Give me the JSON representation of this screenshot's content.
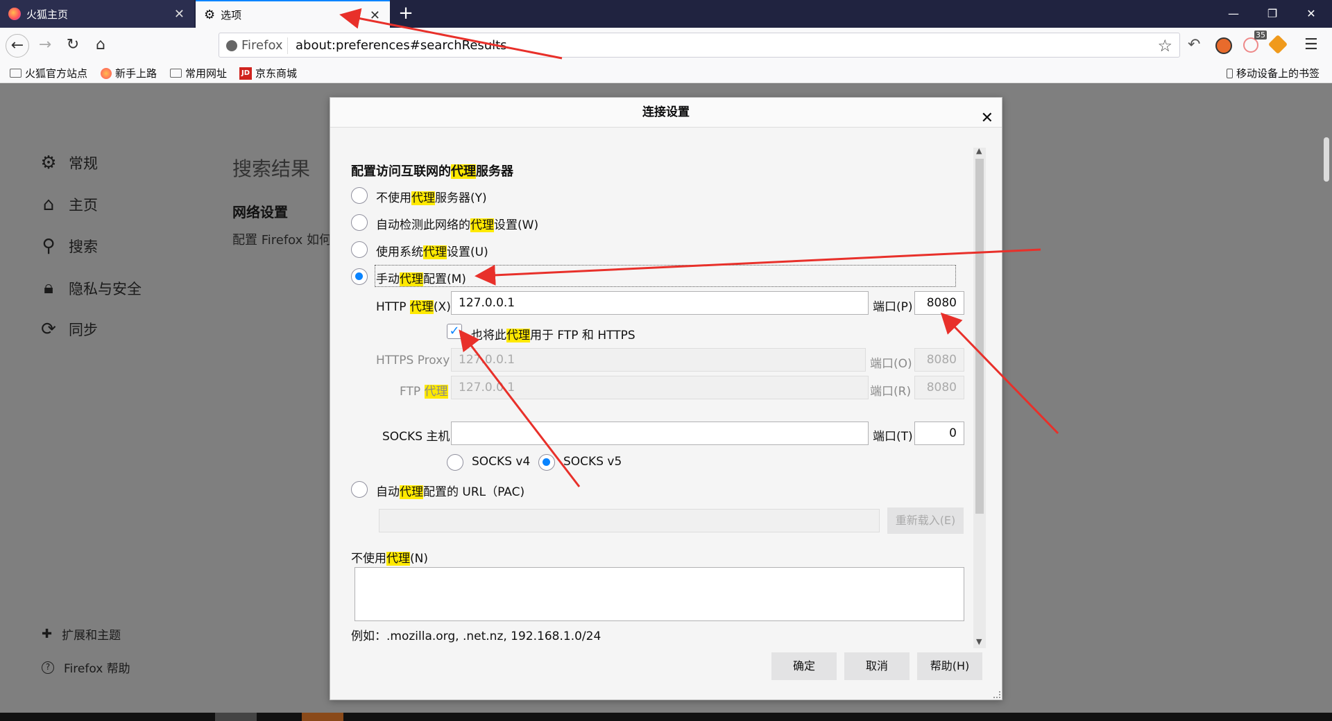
{
  "tabs": [
    {
      "title": "火狐主页"
    },
    {
      "title": "选项"
    }
  ],
  "navbar": {
    "brand": "Firefox",
    "url": "about:preferences#searchResults",
    "badge": "35"
  },
  "bookmarks": [
    {
      "label": "火狐官方站点",
      "icon": "folder-icon"
    },
    {
      "label": "新手上路",
      "icon": "firefox-icon"
    },
    {
      "label": "常用网址",
      "icon": "folder-icon"
    },
    {
      "label": "京东商城",
      "icon": "jd-icon"
    }
  ],
  "mobile_bookmarks": "移动设备上的书签",
  "sidebar": {
    "items": [
      {
        "label": "常规",
        "icon": "gear-icon"
      },
      {
        "label": "主页",
        "icon": "home-icon"
      },
      {
        "label": "搜索",
        "icon": "search-icon"
      },
      {
        "label": "隐私与安全",
        "icon": "lock-icon"
      },
      {
        "label": "同步",
        "icon": "sync-icon"
      }
    ],
    "extensions": "扩展和主题",
    "help": "Firefox 帮助"
  },
  "main": {
    "heading": "搜索结果",
    "section": "网络设置",
    "desc": "配置 Firefox 如何"
  },
  "dialog": {
    "title": "连接设置",
    "heading_pre": "配置访问互联网的",
    "heading_hl": "代理",
    "heading_post": "服务器",
    "options": {
      "no_proxy": {
        "pre": "不使用",
        "hl": "代理",
        "post": "服务器(Y)"
      },
      "auto_detect": {
        "pre": "自动检测此网络的",
        "hl": "代理",
        "post": "设置(W)"
      },
      "system": {
        "pre": "使用系统",
        "hl": "代理",
        "post": "设置(U)"
      },
      "manual": {
        "pre": "手动",
        "hl": "代理",
        "post": "配置(M)"
      },
      "pac": {
        "pre": "自动",
        "hl": "代理",
        "post": "配置的 URL（PAC)"
      }
    },
    "selected": "manual",
    "http": {
      "pre": "HTTP ",
      "hl": "代理",
      "post": "(X)",
      "value": "127.0.0.1",
      "port_label": "端口(P)",
      "port": "8080"
    },
    "also_use": {
      "pre": "也将此",
      "hl": "代理",
      "post": "用于 FTP 和 HTTPS",
      "checked": true
    },
    "https": {
      "label": "HTTPS Proxy",
      "value": "127.0.0.1",
      "port_label": "端口(O)",
      "port": "8080"
    },
    "ftp": {
      "pre": "FTP ",
      "hl": "代理",
      "value": "127.0.0.1",
      "port_label": "端口(R)",
      "port": "8080"
    },
    "socks": {
      "label": "SOCKS 主机",
      "value": "",
      "port_label": "端口(T)",
      "port": "0",
      "v4": "SOCKS v4",
      "v5": "SOCKS v5",
      "selected": "v5"
    },
    "reload": "重新载入(E)",
    "no_proxy_for": {
      "pre": "不使用",
      "hl": "代理",
      "post": "(N)"
    },
    "example": "例如：.mozilla.org, .net.nz, 192.168.1.0/24",
    "buttons": {
      "ok": "确定",
      "cancel": "取消",
      "help": "帮助(H)"
    }
  },
  "colors": {
    "accent": "#0a84ff",
    "highlight": "#ffe900",
    "arrow": "#e8302a"
  }
}
